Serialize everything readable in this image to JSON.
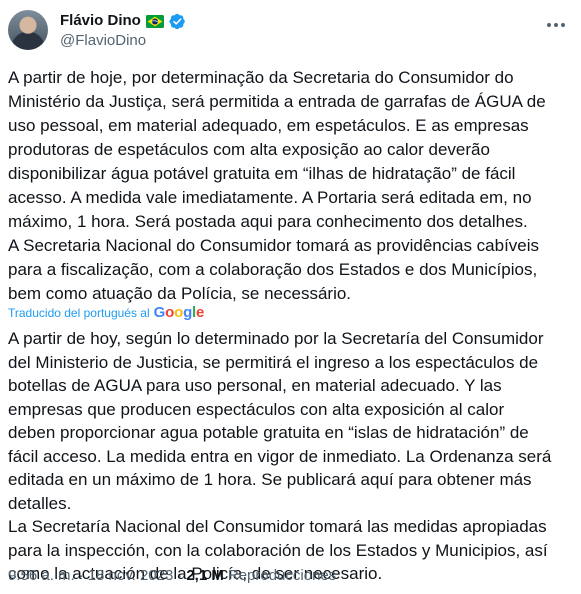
{
  "author": {
    "display_name": "Flávio Dino",
    "handle": "@FlavioDino",
    "flag_icon": "brazil-flag-icon",
    "verified_icon": "verified-badge-icon",
    "verified_color": "#1d9bf0"
  },
  "tweet": {
    "text": "A partir de hoje, por determinação da Secretaria do Consumidor do\nMinistério da Justiça, será permitida a entrada de garrafas de ÁGUA de\nuso pessoal, em material adequado, em espetáculos. E as empresas\nprodutoras de espetáculos com alta exposição ao calor deverão\ndisponibilizar água potável gratuita em “ilhas de hidratação” de fácil\nacesso. A medida vale imediatamente. A Portaria será editada em, no\nmáximo, 1 hora. Será postada aqui para conhecimento dos detalhes.\nA Secretaria Nacional do Consumidor tomará as providências cabíveis\npara a fiscalização, com a colaboração dos Estados e dos Municípios,\nbem como atuação da Polícia, se necessário.",
    "translated_by_label": "Traducido del portugués al",
    "translation_provider": "Google",
    "translation": "A partir de hoy, según lo determinado por la Secretaría del Consumidor\ndel Ministerio de Justicia, se permitirá el ingreso a los espectáculos de\nbotellas de AGUA para uso personal, en material adecuado. Y las\nempresas que producen espectáculos con alta exposición al calor\ndeben proporcionar agua potable gratuita en “islas de hidratación” de\nfácil acceso. La medida entra en vigor de inmediato. La Ordenanza será\neditada en un máximo de 1 hora. Se publicará aquí para obtener más\ndetalles.\nLa Secretaría Nacional del Consumidor tomará las medidas apropiadas\npara la inspección, con la colaboración de los Estados y Municipios, así\ncomo la actuación de la Policía, de ser necesario."
  },
  "meta": {
    "time": "9:56 a. m.",
    "separator": "·",
    "date": "18 nov. 2023",
    "views_count": "2,1 M",
    "views_label": "Reproducciones"
  },
  "icons": {
    "more": "more-options-icon",
    "google_logo": "google-logo"
  },
  "colors": {
    "text": "#0f1419",
    "secondary": "#536471",
    "link": "#1d9bf0"
  }
}
